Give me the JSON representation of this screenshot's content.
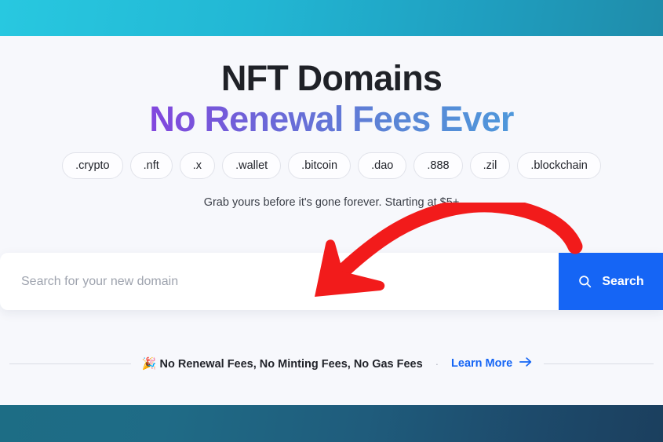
{
  "theme": {
    "accent_blue": "#1565f5",
    "headline_dark": "#1f2127",
    "gradient_start": "#9128e8",
    "gradient_end": "#46a1de",
    "top_bar_start": "#28c8e0",
    "top_bar_end": "#1f8caa",
    "bottom_bar_start": "#1d6d85",
    "bottom_bar_end": "#1b3f5e",
    "page_background": "#f7f8fc",
    "annotation_red": "#f21b1b"
  },
  "hero": {
    "headline_line1": "NFT Domains",
    "headline_line2": "No Renewal Fees Ever",
    "subtitle": "Grab yours before it's gone forever. Starting at $5+",
    "tlds": [
      {
        "label": ".crypto"
      },
      {
        "label": ".nft"
      },
      {
        "label": ".x"
      },
      {
        "label": ".wallet"
      },
      {
        "label": ".bitcoin"
      },
      {
        "label": ".dao"
      },
      {
        "label": ".888"
      },
      {
        "label": ".zil"
      },
      {
        "label": ".blockchain"
      }
    ]
  },
  "search": {
    "placeholder": "Search for your new domain",
    "value": "",
    "button_label": "Search",
    "button_icon": "search-icon"
  },
  "promo": {
    "emoji": "🎉",
    "text": "No Renewal Fees, No Minting Fees, No Gas Fees",
    "separator": "·",
    "link_label": "Learn More",
    "link_icon": "arrow-right-icon"
  },
  "annotation": {
    "type": "curved-arrow",
    "color": "#f21b1b",
    "points_to": "search-input",
    "direction": "right-to-left-downward"
  }
}
